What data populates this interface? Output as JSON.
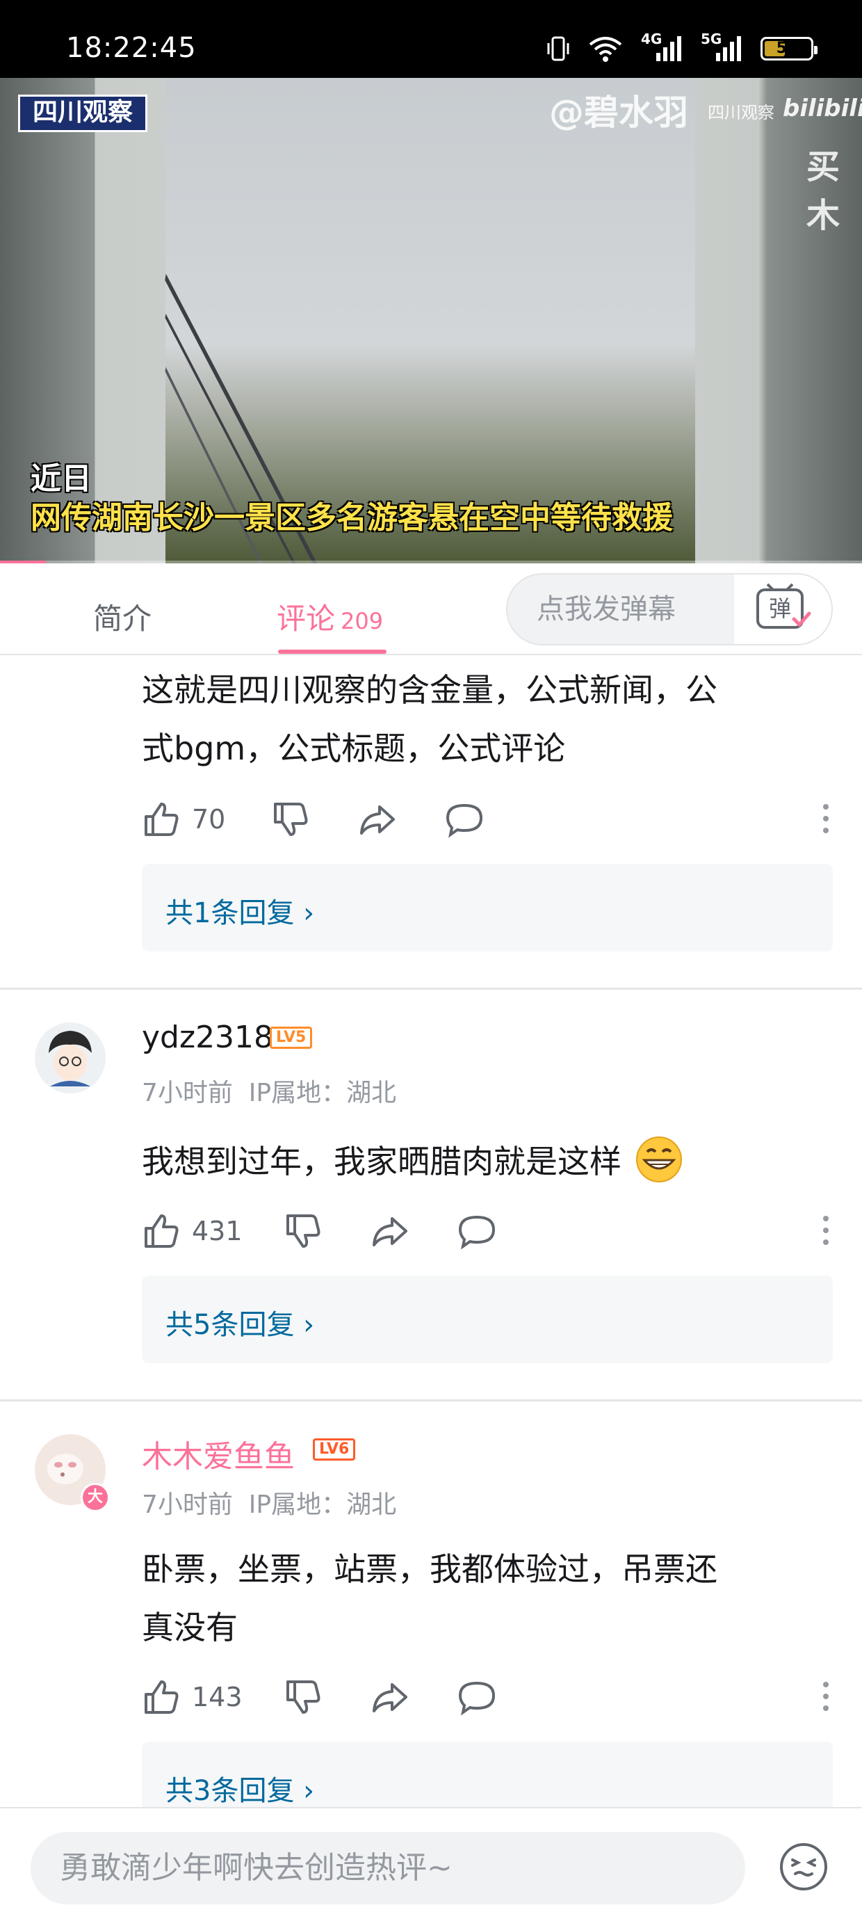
{
  "status_bar": {
    "time": "18:22:45",
    "network1": "4G",
    "network2": "5G",
    "battery_level": "50"
  },
  "video": {
    "channel_logo": "四川观察",
    "watermark_user": "@碧水羽",
    "watermark_site": "四川观察",
    "watermark_brand": "bilibili",
    "watermark_right": "买木",
    "caption_line1": "近日",
    "caption_line2": "网传湖南长沙一景区多名游客悬在空中等待救援",
    "progress_fraction": 0.053
  },
  "tabs": {
    "intro": "简介",
    "comments": "评论",
    "comments_count": "209",
    "danmaku_placeholder": "点我发弹幕",
    "danmaku_toggle_icon": "弹"
  },
  "comments": [
    {
      "text_line1": "这就是四川观察的含金量，公式新闻，公",
      "text_line2": "式bgm，公式标题，公式评论",
      "likes": "70",
      "replies": "共1条回复"
    },
    {
      "username": "ydz2318",
      "level": "LV5",
      "time": "7小时前",
      "ip": "IP属地：湖北",
      "text": "我想到过年，我家晒腊肉就是这样",
      "emoji": "grinning-face-emoji",
      "likes": "431",
      "replies": "共5条回复"
    },
    {
      "username": "木木爱鱼鱼",
      "level": "LV6",
      "avatar_badge": "大",
      "time": "7小时前",
      "ip": "IP属地：湖北",
      "text_line1": "卧票，坐票，站票，我都体验过，吊票还",
      "text_line2": "真没有",
      "likes": "143",
      "replies": "共3条回复"
    }
  ],
  "bottom_bar": {
    "input_placeholder": "勇敢滴少年啊快去创造热评~",
    "emoji_icon": "emoji-face-icon"
  },
  "colors": {
    "accent": "#fb7299",
    "reply_link": "#00699d",
    "level5": "#ff8c2a",
    "level6": "#ff5b2a",
    "caption_yellow": "#ffe24a"
  }
}
